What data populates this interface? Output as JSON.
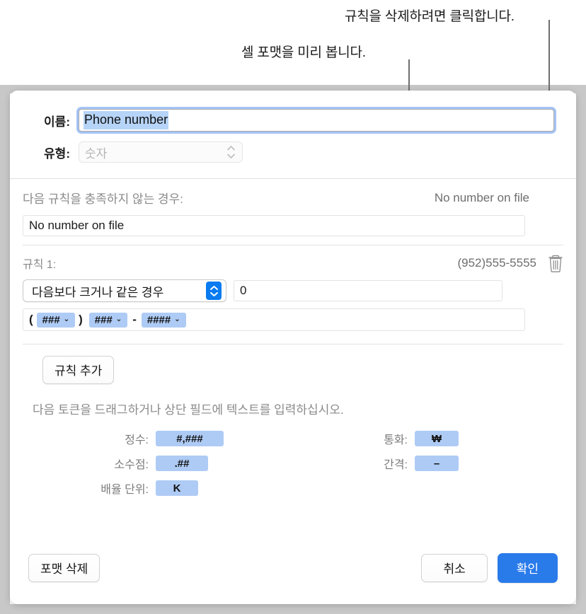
{
  "callouts": [
    {
      "id": "delete-rule",
      "text": "규칙을 삭제하려면 클릭합니다."
    },
    {
      "id": "preview",
      "text": "셀 포맷을 미리 봅니다."
    }
  ],
  "dialog": {
    "name_row": {
      "label": "이름:",
      "value": "Phone number"
    },
    "type_row": {
      "label": "유형:",
      "value": "숫자",
      "chevron_icon": "chevron-up-down-icon"
    },
    "fallback": {
      "label": "다음 규칙을 충족하지 않는 경우:",
      "preview": "No number on file",
      "value": "No number on file"
    },
    "rule": {
      "label": "규칙 1:",
      "preview": "(952)555-5555",
      "delete_icon": "trash-icon",
      "condition": "다음보다 크거나 같은 경우",
      "condition_chevron_icon": "chevron-up-down-icon",
      "threshold": "0",
      "format_tokens": [
        {
          "kind": "literal",
          "text": "("
        },
        {
          "kind": "token",
          "text": "###",
          "caret": "⌄"
        },
        {
          "kind": "literal",
          "text": ")"
        },
        {
          "kind": "token",
          "text": "###",
          "caret": "⌄"
        },
        {
          "kind": "literal",
          "text": "-"
        },
        {
          "kind": "token",
          "text": "####",
          "caret": "⌄"
        }
      ]
    },
    "add_rule_label": "규칙 추가",
    "token_hint": "다음 토큰을 드래그하거나 상단 필드에 텍스트를 입력하십시오.",
    "token_palette_left": [
      {
        "label": "정수:",
        "token": "#,###"
      },
      {
        "label": "소수점:",
        "token": ".##"
      },
      {
        "label": "배율 단위:",
        "token": "K"
      }
    ],
    "token_palette_right": [
      {
        "label": "통화:",
        "token": "₩"
      },
      {
        "label": "간격:",
        "token": "–"
      }
    ],
    "footer": {
      "delete_format": "포맷 삭제",
      "cancel": "취소",
      "confirm": "확인"
    }
  },
  "colors": {
    "accent_blue": "#2a7bea",
    "popup_blue": "#0a7bf0",
    "token_blue": "#aecbf5",
    "selection_blue": "#b6d4f7",
    "focus_ring": "#6ea0f0",
    "backdrop_gray": "#c8c8c8",
    "preview_gray": "#6e6e6e"
  }
}
